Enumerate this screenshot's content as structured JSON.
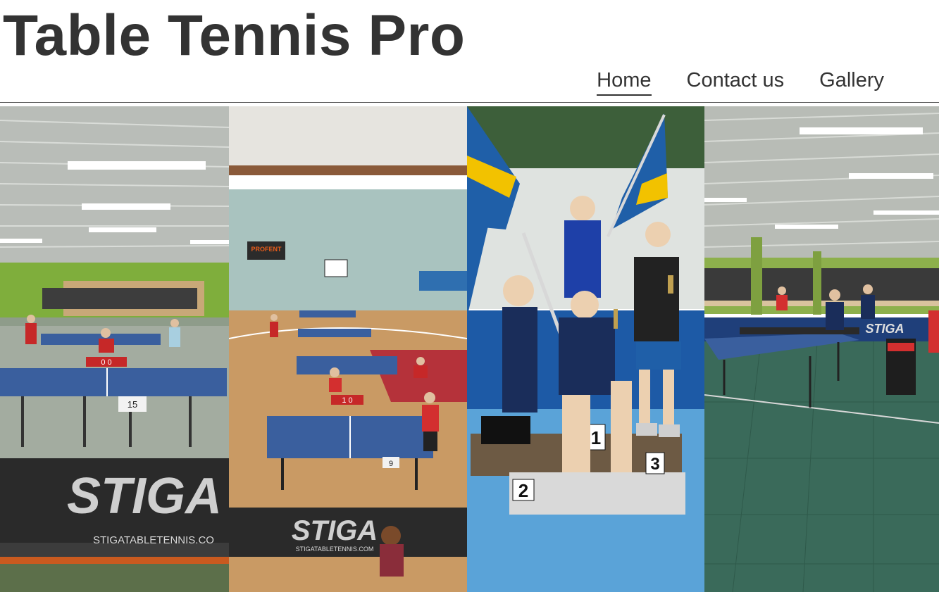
{
  "site": {
    "title": "Table Tennis Pro"
  },
  "nav": {
    "items": [
      {
        "label": "Home",
        "active": true
      },
      {
        "label": "Contact us",
        "active": false
      },
      {
        "label": "Gallery",
        "active": false
      }
    ]
  },
  "gallery": {
    "photos": [
      {
        "alt": "Table tennis hall with STIGA tables",
        "banner": "STIGA",
        "url_text": "STIGATABLETENNIS.CO",
        "table_number": "15",
        "score": "0 0"
      },
      {
        "alt": "Sports hall with several table tennis tables",
        "sign": "PROFENT",
        "banner": "STIGA",
        "url_text": "STIGATABLETENNIS.COM",
        "table_number": "9",
        "score": "1 0"
      },
      {
        "alt": "Podium with three young players and Swedish flags",
        "places": [
          "1",
          "2",
          "3"
        ]
      },
      {
        "alt": "Green-floored hall with table tennis tables",
        "banner": "STIGA"
      }
    ]
  },
  "colors": {
    "text": "#333333",
    "table_blue": "#3a5f9e",
    "flag_blue": "#1f5fa8",
    "flag_yellow": "#f2c200"
  }
}
